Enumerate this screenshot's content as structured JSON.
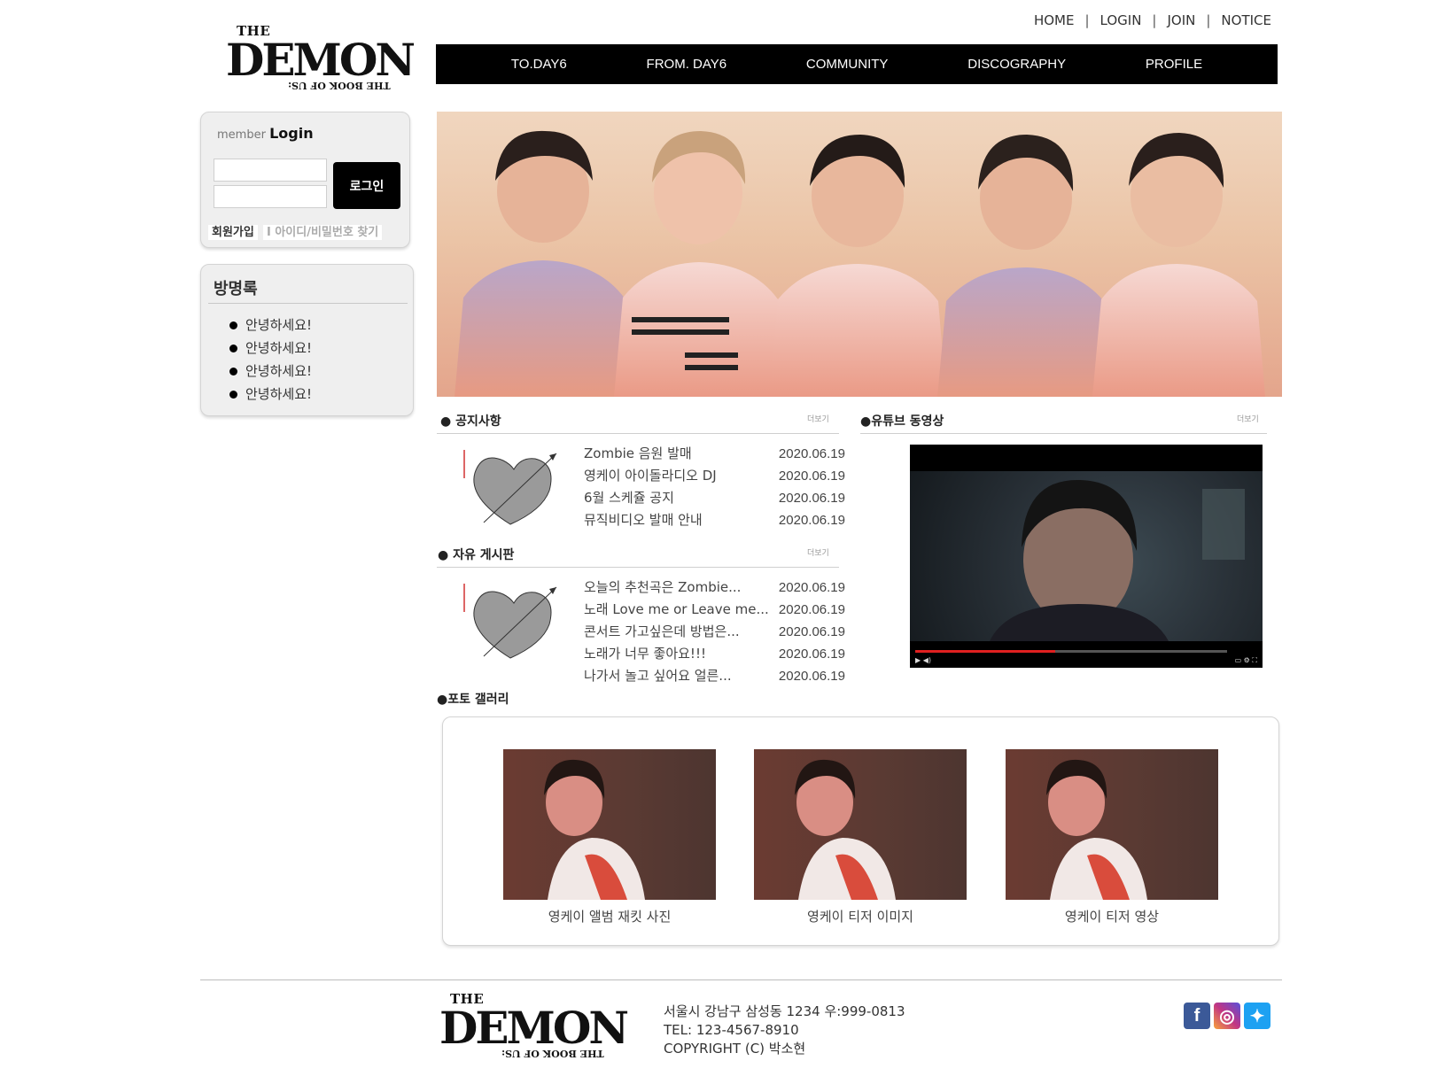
{
  "logo": {
    "the": "THE",
    "word": "DEMON",
    "sub": "THE BOOK OF US:"
  },
  "topnav": {
    "home": "HOME",
    "login": "LOGIN",
    "join": "JOIN",
    "notice": "NOTICE",
    "sep": "|"
  },
  "mainnav": [
    "TO.DAY6",
    "FROM. DAY6",
    "COMMUNITY",
    "DISCOGRAPHY",
    "PROFILE"
  ],
  "login": {
    "title_prefix": "member",
    "title": "Login",
    "button": "로그인",
    "join_link": "회원가입",
    "find_link": "I 아이디/비밀번호 찾기"
  },
  "guestbook": {
    "title": "방명록",
    "items": [
      "안녕하세요!",
      "안녕하세요!",
      "안녕하세요!",
      "안녕하세요!"
    ]
  },
  "notice": {
    "title": "● 공지사항",
    "more": "더보기",
    "posts": [
      {
        "title": "Zombie 음원 발매",
        "date": "2020.06.19"
      },
      {
        "title": "영케이 아이돌라디오 DJ",
        "date": "2020.06.19"
      },
      {
        "title": "6월 스케쥴 공지",
        "date": "2020.06.19"
      },
      {
        "title": "뮤직비디오 발매 안내",
        "date": "2020.06.19"
      }
    ]
  },
  "board": {
    "title": "● 자유 게시판",
    "more": "더보기",
    "posts": [
      {
        "title": "오늘의 추천곡은 Zombie...",
        "date": "2020.06.19"
      },
      {
        "title": "노래 Love me or Leave me...",
        "date": "2020.06.19"
      },
      {
        "title": "콘서트 가고싶은데 방법은...",
        "date": "2020.06.19"
      },
      {
        "title": "노래가 너무 좋아요!!!",
        "date": "2020.06.19"
      },
      {
        "title": "나가서 놀고 싶어요 얼른...",
        "date": "2020.06.19"
      }
    ]
  },
  "youtube": {
    "title": "●유튜브 동영상",
    "more": "더보기",
    "progress": 0.45
  },
  "gallery": {
    "title": "●포토 갤러리",
    "items": [
      {
        "caption": "영케이 앨범 재킷 사진"
      },
      {
        "caption": "영케이 티저 이미지"
      },
      {
        "caption": "영케이 티저 영상"
      }
    ]
  },
  "footer": {
    "address": "서울시 강남구 삼성동 1234 우:999-0813",
    "tel": "TEL: 123-4567-8910",
    "copyright": "COPYRIGHT (C) 박소현",
    "social": [
      {
        "name": "facebook-icon",
        "glyph": "f",
        "color": "#3b5998"
      },
      {
        "name": "instagram-icon",
        "glyph": "◎",
        "color": "#c13584"
      },
      {
        "name": "twitter-icon",
        "glyph": "✦",
        "color": "#1da1f2"
      }
    ]
  }
}
